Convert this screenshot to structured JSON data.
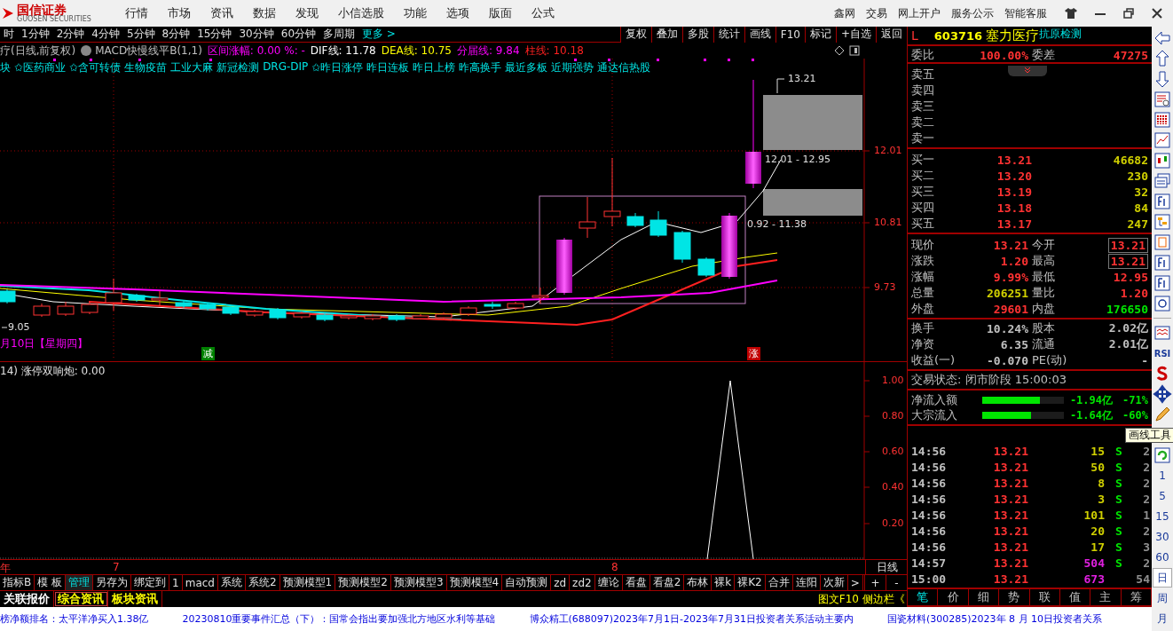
{
  "menu_bar": {
    "logo_name": "国信证券",
    "logo_subtitle": "GUOSEN SECURITIES",
    "menu": [
      "行情",
      "市场",
      "资讯",
      "数据",
      "发现",
      "小信选股",
      "功能",
      "选项",
      "版面",
      "公式"
    ],
    "links": [
      "鑫网",
      "交易",
      "网上开户",
      "服务公示",
      "智能客服"
    ]
  },
  "period_bar": {
    "periods": [
      "时",
      "1分钟",
      "2分钟",
      "4分钟",
      "5分钟",
      "8分钟",
      "15分钟",
      "30分钟",
      "60分钟",
      "多周期"
    ],
    "more": "更多 >"
  },
  "chart_toolbar": [
    "复权",
    "叠加",
    "多股",
    "统计",
    "画线",
    "F10",
    "标记",
    "+自选",
    "返回"
  ],
  "indicator_line": {
    "title": "疗(日线,前复权)",
    "formula": "MACD快慢线平B(1,1)",
    "items": [
      {
        "label": "区间涨幅: 0.00 %: -",
        "color": "#ff00ff"
      },
      {
        "label": "DIF线: 11.78",
        "color": "#ffffff"
      },
      {
        "label": "DEA线: 10.75",
        "color": "#ffff00"
      },
      {
        "label": "分届线: 9.84",
        "color": "#ff00ff"
      },
      {
        "label": "柱线: 10.18",
        "color": "#ff2020"
      }
    ]
  },
  "concept_tags": [
    "块",
    "✩医药商业",
    "✩含可转债",
    "生物疫苗",
    "工业大麻",
    "新冠检测",
    "DRG-DIP",
    "✩昨日涨停",
    "昨日连板",
    "昨日上榜",
    "昨高换手",
    "最近多板",
    "近期强势",
    "通达信热股"
  ],
  "main_chart": {
    "price_labels": [
      "12.01",
      "10.81",
      "9.73"
    ],
    "annotations": [
      "13.21",
      "12.01 - 12.95",
      "0.92 - 11.38"
    ],
    "low_label": "9.05",
    "date_label": "月10日【星期四】",
    "markers": [
      {
        "label": "减",
        "kind": "down"
      },
      {
        "label": "涨",
        "kind": "up"
      }
    ]
  },
  "sub_chart": {
    "title": "14) 涨停双响炮: 0.00",
    "axis": [
      "1.00",
      "0.80",
      "0.60",
      "0.40",
      "0.20"
    ]
  },
  "date_axis": {
    "labels": [
      "年",
      "7",
      "8"
    ],
    "period": "日线"
  },
  "formula_tabs": [
    {
      "label": "指标B",
      "selected": false
    },
    {
      "label": "模 板",
      "selected": false
    },
    {
      "label": "管理",
      "selected": true
    },
    {
      "label": "另存为",
      "selected": false
    },
    {
      "label": "绑定到",
      "selected": false
    },
    {
      "label": "1",
      "selected": false
    },
    {
      "label": "macd",
      "selected": false
    },
    {
      "label": "系统",
      "selected": false
    },
    {
      "label": "系统2",
      "selected": false
    },
    {
      "label": "预测模型1",
      "selected": false
    },
    {
      "label": "预测模型2",
      "selected": false
    },
    {
      "label": "预测模型3",
      "selected": false
    },
    {
      "label": "预测模型4",
      "selected": false
    },
    {
      "label": "自动预测",
      "selected": false
    },
    {
      "label": "zd",
      "selected": false
    },
    {
      "label": "zd2",
      "selected": false
    },
    {
      "label": "缠论",
      "selected": false
    },
    {
      "label": "看盘",
      "selected": false
    },
    {
      "label": "看盘2",
      "selected": false
    },
    {
      "label": "布林",
      "selected": false
    },
    {
      "label": "裸k",
      "selected": false
    },
    {
      "label": "裸K2",
      "selected": false
    },
    {
      "label": "合并",
      "selected": false
    },
    {
      "label": "连阳",
      "selected": false
    },
    {
      "label": "次新",
      "selected": false
    },
    {
      "label": ">",
      "selected": false
    }
  ],
  "zoom_buttons": [
    "+",
    "-"
  ],
  "info_tabs": [
    {
      "label": "关联报价",
      "kind": "quote",
      "selected": false
    },
    {
      "label": "综合资讯",
      "kind": "news",
      "selected": true
    },
    {
      "label": "板块资讯",
      "kind": "news",
      "selected": false
    }
  ],
  "side_links": [
    "图文F10",
    "侧边栏《"
  ],
  "news_ticker": [
    "榜净额排名：太平洋净买入1.38亿",
    "20230810重要事件汇总（下）：国常会指出要加强北方地区水利等基础",
    "博众精工(688097)2023年7月1日-2023年7月31日投资者关系活动主要内",
    "国瓷材料(300285)2023年 8 月 10日投资者关系"
  ],
  "quote": {
    "flag": "L",
    "code": "603716",
    "name": "塞力医疗",
    "concept": "抗原检测",
    "ratio": {
      "label": "委比",
      "value": "100.00%",
      "label2": "委差",
      "value2": "47275"
    },
    "asks": [
      "卖五",
      "卖四",
      "卖三",
      "卖二",
      "卖一"
    ],
    "bids": [
      {
        "label": "买一",
        "price": "13.21",
        "volume": "46682"
      },
      {
        "label": "买二",
        "price": "13.20",
        "volume": "230"
      },
      {
        "label": "买三",
        "price": "13.19",
        "volume": "32"
      },
      {
        "label": "买四",
        "price": "13.18",
        "volume": "84"
      },
      {
        "label": "买五",
        "price": "13.17",
        "volume": "247"
      }
    ],
    "stats": [
      {
        "left": {
          "label": "现价",
          "value": "13.21",
          "color": "#ff3232"
        },
        "right": {
          "label": "今开",
          "value": "13.21",
          "color": "#ff3232",
          "boxed": true
        }
      },
      {
        "left": {
          "label": "涨跌",
          "value": "1.20",
          "color": "#ff3232"
        },
        "right": {
          "label": "最高",
          "value": "13.21",
          "color": "#ff3232",
          "boxed": true
        }
      },
      {
        "left": {
          "label": "涨幅",
          "value": "9.99%",
          "color": "#ff3232"
        },
        "right": {
          "label": "最低",
          "value": "12.95",
          "color": "#ff3232",
          "boxed": false
        }
      },
      {
        "left": {
          "label": "总量",
          "value": "206251",
          "color": "#d0d000"
        },
        "right": {
          "label": "量比",
          "value": "1.20",
          "color": "#ff3232",
          "boxed": false
        }
      },
      {
        "left": {
          "label": "外盘",
          "value": "29601",
          "color": "#ff3232"
        },
        "right": {
          "label": "内盘",
          "value": "176650",
          "color": "#00e600",
          "boxed": false
        }
      }
    ],
    "fundamentals": [
      {
        "label": "换手",
        "value": "10.24%",
        "label2": "股本",
        "value2": "2.02亿"
      },
      {
        "label": "净资",
        "value": "6.35",
        "label2": "流通",
        "value2": "2.01亿"
      },
      {
        "label": "收益(一)",
        "value": "-0.070",
        "label2": "PE(动)",
        "value2": "-"
      }
    ],
    "trade_status": "交易状态: 闭市阶段 15:00:03",
    "flows": [
      {
        "label": "净流入额",
        "level": 0.71,
        "value": "-1.94亿",
        "pct": "-71%"
      },
      {
        "label": "大宗流入",
        "level": 0.6,
        "value": "-1.64亿",
        "pct": "-60%"
      }
    ],
    "trades": [
      {
        "time": "14:56",
        "price": "13.21",
        "volume": "15",
        "large": false,
        "side": "S",
        "count": "2"
      },
      {
        "time": "14:56",
        "price": "13.21",
        "volume": "50",
        "large": false,
        "side": "S",
        "count": "2"
      },
      {
        "time": "14:56",
        "price": "13.21",
        "volume": "8",
        "large": false,
        "side": "S",
        "count": "2"
      },
      {
        "time": "14:56",
        "price": "13.21",
        "volume": "3",
        "large": false,
        "side": "S",
        "count": "2"
      },
      {
        "time": "14:56",
        "price": "13.21",
        "volume": "101",
        "large": false,
        "side": "S",
        "count": "1"
      },
      {
        "time": "14:56",
        "price": "13.21",
        "volume": "20",
        "large": false,
        "side": "S",
        "count": "2"
      },
      {
        "time": "14:56",
        "price": "13.21",
        "volume": "17",
        "large": false,
        "side": "S",
        "count": "3"
      },
      {
        "time": "14:57",
        "price": "13.21",
        "volume": "504",
        "large": true,
        "side": "S",
        "count": "2"
      },
      {
        "time": "15:00",
        "price": "13.21",
        "volume": "673",
        "large": true,
        "count": "54"
      }
    ],
    "tabs": [
      {
        "label": "笔",
        "selected": true
      },
      {
        "label": "价",
        "selected": false
      },
      {
        "label": "细",
        "selected": false
      },
      {
        "label": "势",
        "selected": false
      },
      {
        "label": "联",
        "selected": false
      },
      {
        "label": "值",
        "selected": false
      },
      {
        "label": "主",
        "selected": false
      },
      {
        "label": "筹",
        "selected": false
      }
    ]
  },
  "side_toolbar": {
    "rsi_label": "RSI",
    "tooltip": "画线工具",
    "periods": [
      {
        "label": "1",
        "selected": false
      },
      {
        "label": "5",
        "selected": false
      },
      {
        "label": "15",
        "selected": false
      },
      {
        "label": "30",
        "selected": false
      },
      {
        "label": "60",
        "selected": false
      },
      {
        "label": "日",
        "selected": true
      },
      {
        "label": "周",
        "selected": false
      },
      {
        "label": "月",
        "selected": false
      }
    ]
  }
}
